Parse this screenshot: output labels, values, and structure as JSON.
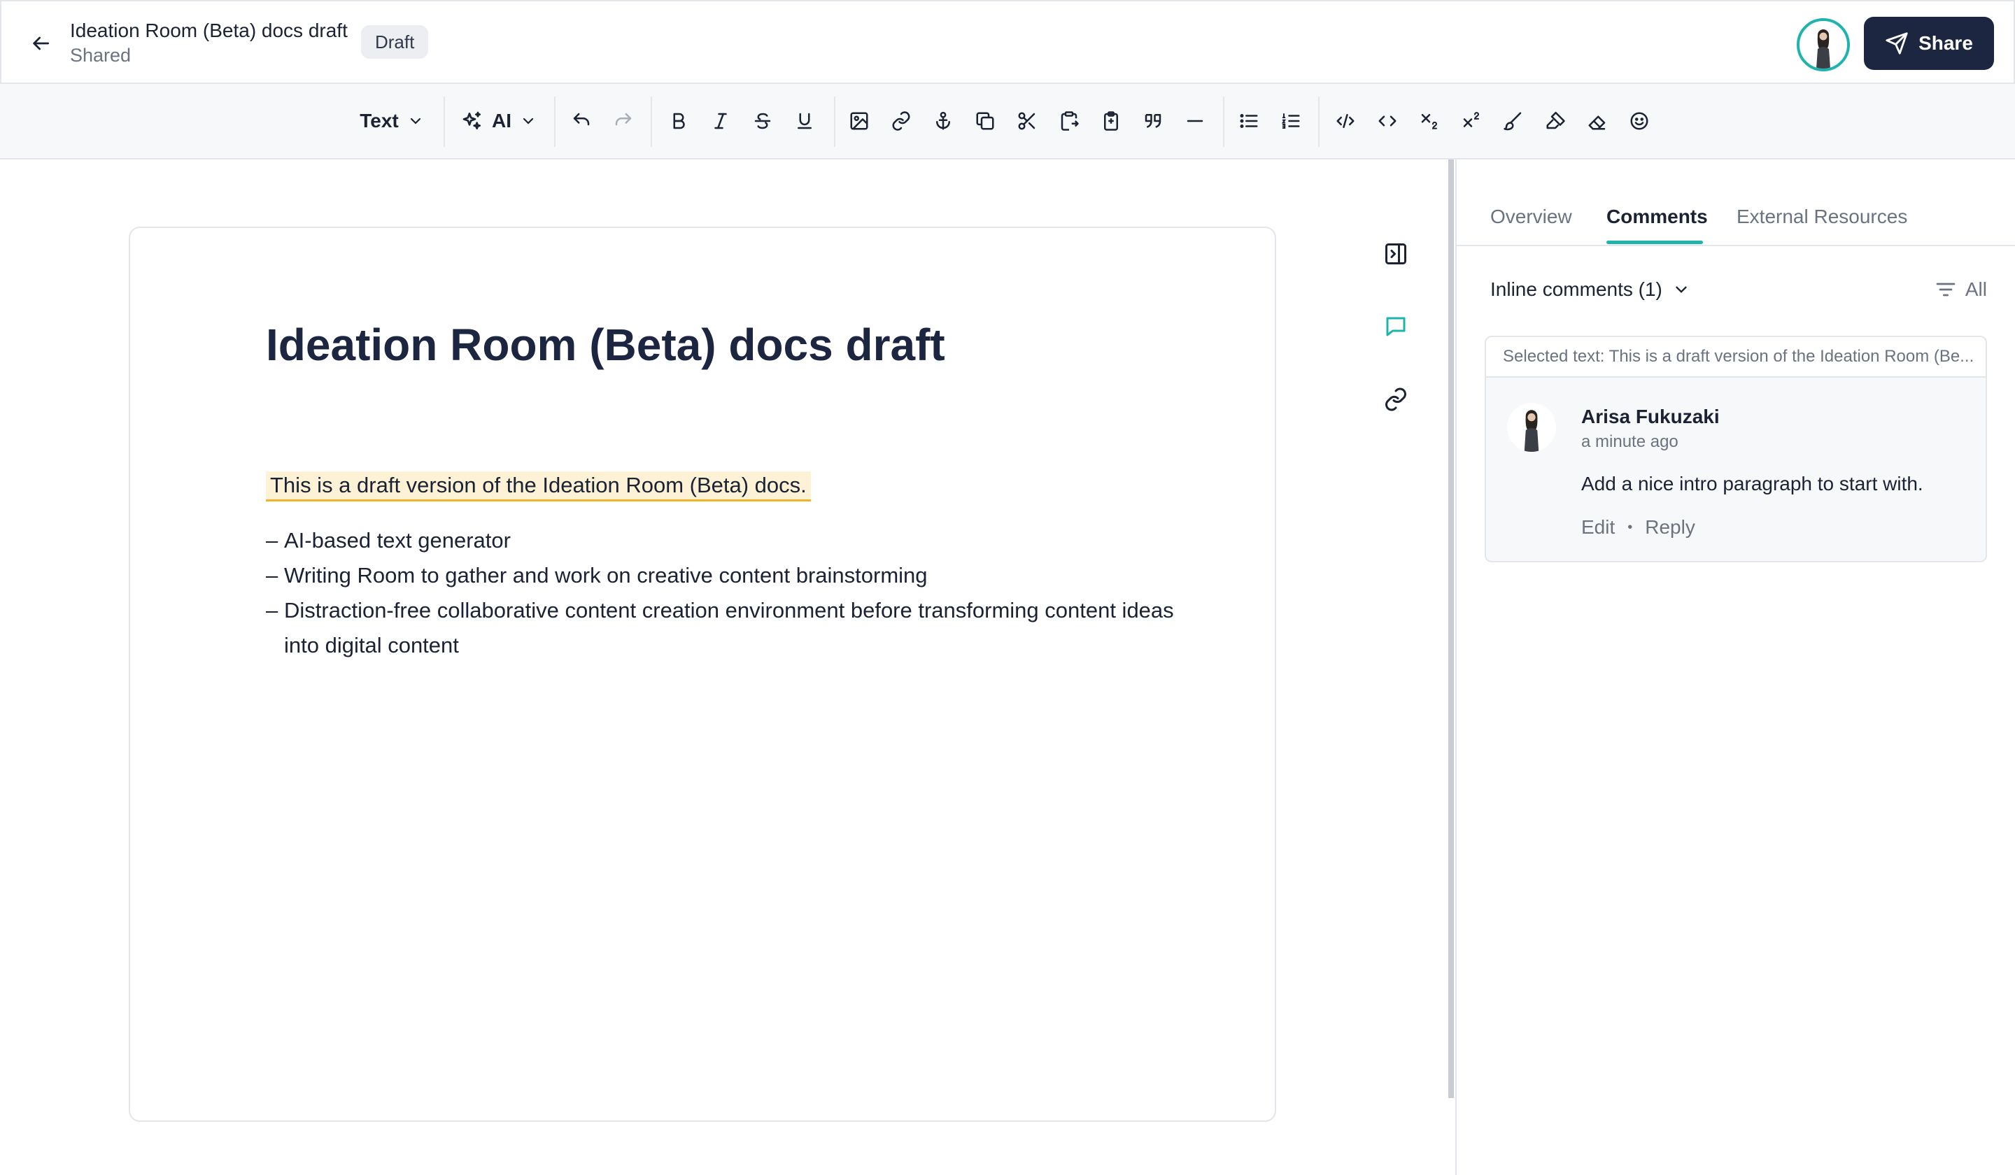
{
  "header": {
    "doc_title": "Ideation Room (Beta) docs draft",
    "doc_subtitle": "Shared",
    "status_badge": "Draft",
    "share_label": "Share"
  },
  "toolbar": {
    "text_style_label": "Text",
    "ai_label": "AI",
    "icons": [
      "undo-icon",
      "redo-icon",
      "bold-icon",
      "italic-icon",
      "strikethrough-icon",
      "underline-icon",
      "image-icon",
      "link-icon",
      "anchor-icon",
      "copy-icon",
      "cut-icon",
      "paste-icon",
      "clipboard-icon",
      "quote-icon",
      "horizontal-rule-icon",
      "bullet-list-icon",
      "numbered-list-icon",
      "code-block-icon",
      "inline-code-icon",
      "subscript-icon",
      "superscript-icon",
      "brush-icon",
      "highlighter-icon",
      "eraser-icon",
      "emoji-icon"
    ]
  },
  "document": {
    "title": "Ideation Room (Beta) docs draft",
    "highlighted_paragraph": "This is a draft version of the Ideation Room (Beta) docs.",
    "bullets": [
      {
        "dash": "–",
        "text": "AI-based text generator"
      },
      {
        "dash": "–",
        "text": "Writing Room to gather and work on creative content brainstorming"
      },
      {
        "dash": "–",
        "text": "Distraction-free collaborative content creation environment before transforming content ideas into digital content"
      }
    ]
  },
  "panel": {
    "tabs": [
      {
        "label": "Overview",
        "active": false
      },
      {
        "label": "Comments",
        "active": true
      },
      {
        "label": "External Resources",
        "active": false
      }
    ],
    "inline_comments_label": "Inline comments (1)",
    "filter_label": "All",
    "comment": {
      "selected_text": "Selected text: This is a draft version of the Ideation Room (Be...",
      "author": "Arisa Fukuzaki",
      "time": "a minute ago",
      "body": "Add a nice intro paragraph to start with.",
      "edit_label": "Edit",
      "separator": "•",
      "reply_label": "Reply"
    }
  },
  "colors": {
    "accent": "#1fb3ae",
    "primary_dark": "#1c2641",
    "highlight_bg": "#fdf1d6",
    "highlight_underline": "#f0b429"
  }
}
